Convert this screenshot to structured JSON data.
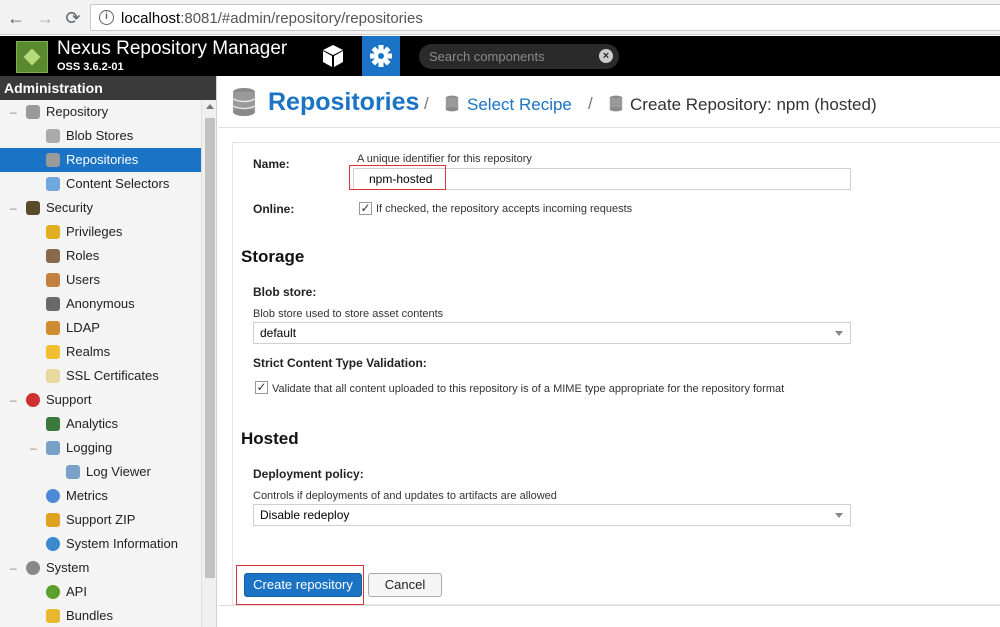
{
  "browser": {
    "url_host": "localhost",
    "url_rest": ":8081/#admin/repository/repositories",
    "icons": [
      "back-icon",
      "forward-icon",
      "reload-icon",
      "info-icon"
    ]
  },
  "header": {
    "title": "Nexus Repository Manager",
    "version": "OSS 3.6.2-01",
    "search_placeholder": "Search components",
    "accent": "#1a73c4"
  },
  "sidebar": {
    "heading": "Administration",
    "items": [
      {
        "label": "Repository",
        "level": 0,
        "toggle": "minus",
        "icon": "database-icon"
      },
      {
        "label": "Blob Stores",
        "level": 1,
        "icon": "blob-store-icon"
      },
      {
        "label": "Repositories",
        "level": 1,
        "icon": "database-icon",
        "selected": true
      },
      {
        "label": "Content Selectors",
        "level": 1,
        "icon": "content-selector-icon"
      },
      {
        "label": "Security",
        "level": 0,
        "toggle": "minus",
        "icon": "badge-icon"
      },
      {
        "label": "Privileges",
        "level": 1,
        "icon": "medal-icon"
      },
      {
        "label": "Roles",
        "level": 1,
        "icon": "role-icon"
      },
      {
        "label": "Users",
        "level": 1,
        "icon": "users-icon"
      },
      {
        "label": "Anonymous",
        "level": 1,
        "icon": "anonymous-icon"
      },
      {
        "label": "LDAP",
        "level": 1,
        "icon": "ldap-book-icon"
      },
      {
        "label": "Realms",
        "level": 1,
        "icon": "shield-icon"
      },
      {
        "label": "SSL Certificates",
        "level": 1,
        "icon": "certificate-icon"
      },
      {
        "label": "Support",
        "level": 0,
        "toggle": "minus",
        "icon": "lifebuoy-icon"
      },
      {
        "label": "Analytics",
        "level": 1,
        "icon": "analytics-icon"
      },
      {
        "label": "Logging",
        "level": 1,
        "toggle": "minus",
        "icon": "logging-icon"
      },
      {
        "label": "Log Viewer",
        "level": 2,
        "icon": "log-viewer-icon"
      },
      {
        "label": "Metrics",
        "level": 1,
        "icon": "pie-chart-icon"
      },
      {
        "label": "Support ZIP",
        "level": 1,
        "icon": "zip-icon"
      },
      {
        "label": "System Information",
        "level": 1,
        "icon": "globe-icon"
      },
      {
        "label": "System",
        "level": 0,
        "toggle": "minus",
        "icon": "gear-icon"
      },
      {
        "label": "API",
        "level": 1,
        "icon": "api-icon"
      },
      {
        "label": "Bundles",
        "level": 1,
        "icon": "puzzle-icon"
      }
    ]
  },
  "breadcrumb": {
    "title": "Repositories",
    "sep1": "/",
    "link": "Select Recipe",
    "sep2": "/",
    "current": "Create Repository: npm (hosted)"
  },
  "form": {
    "name_label": "Name:",
    "name_help": "A unique identifier for this repository",
    "name_value": "npm-hosted",
    "online_label": "Online:",
    "online_checked": true,
    "online_text": "If checked, the repository accepts incoming requests",
    "storage_title": "Storage",
    "blob_label": "Blob store:",
    "blob_help": "Blob store used to store asset contents",
    "blob_value": "default",
    "strict_label": "Strict Content Type Validation:",
    "strict_checked": true,
    "strict_text": "Validate that all content uploaded to this repository is of a MIME type appropriate for the repository format",
    "hosted_title": "Hosted",
    "deploy_label": "Deployment policy:",
    "deploy_help": "Controls if deployments of and updates to artifacts are allowed",
    "deploy_value": "Disable redeploy",
    "create_label": "Create repository",
    "cancel_label": "Cancel",
    "check_mark": "✓"
  }
}
